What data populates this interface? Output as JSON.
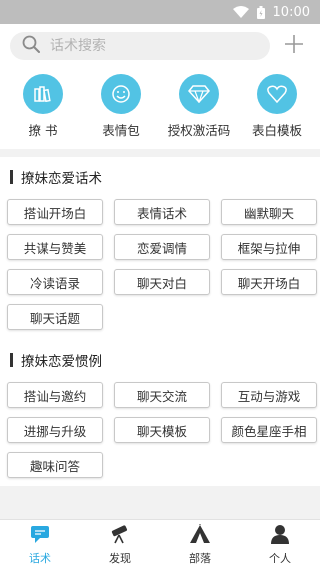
{
  "status_bar": {
    "time": "10:00",
    "wifi_icon": "wifi-icon",
    "battery_icon": "battery-icon"
  },
  "search": {
    "placeholder": "话术搜索"
  },
  "quick_actions": [
    {
      "label": "撩 书",
      "icon": "book-icon"
    },
    {
      "label": "表情包",
      "icon": "smiley-icon"
    },
    {
      "label": "授权激活码",
      "icon": "diamond-icon"
    },
    {
      "label": "表白模板",
      "icon": "heart-icon"
    }
  ],
  "sections": [
    {
      "title": "撩妹恋爱话术",
      "tags": [
        "搭讪开场白",
        "表情话术",
        "幽默聊天",
        "共谋与赞美",
        "恋爱调情",
        "框架与拉伸",
        "冷读语录",
        "聊天对白",
        "聊天开场白",
        "聊天话题"
      ]
    },
    {
      "title": "撩妹恋爱惯例",
      "tags": [
        "搭讪与邀约",
        "聊天交流",
        "互动与游戏",
        "进挪与升级",
        "聊天模板",
        "颜色星座手相",
        "趣味问答"
      ]
    }
  ],
  "bottom_nav": [
    {
      "label": "话术",
      "icon": "chat-icon",
      "active": true
    },
    {
      "label": "发现",
      "icon": "telescope-icon",
      "active": false
    },
    {
      "label": "部落",
      "icon": "tent-icon",
      "active": false
    },
    {
      "label": "个人",
      "icon": "person-icon",
      "active": false
    }
  ],
  "colors": {
    "accent": "#52c3e4",
    "active_nav": "#29a8e0",
    "status_bar": "#bdbdbd"
  }
}
